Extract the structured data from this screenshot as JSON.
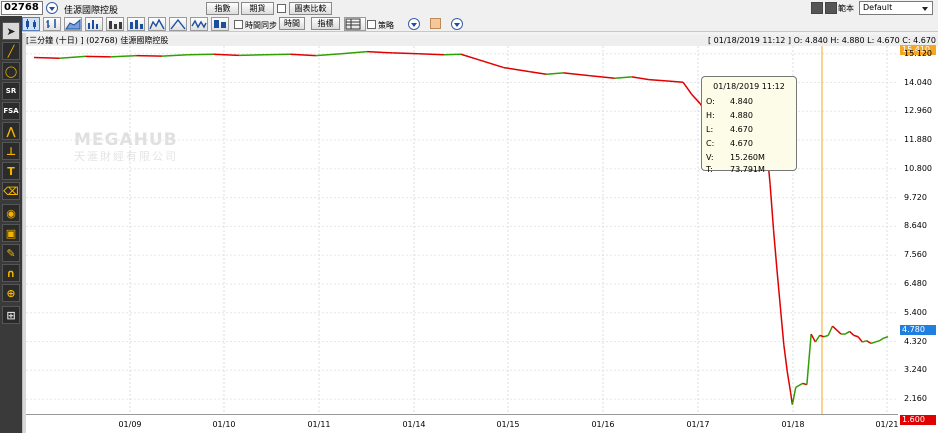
{
  "stock": {
    "code": "02768",
    "name": "佳源國際控股"
  },
  "toolbar": {
    "indicator_btn": "指數",
    "futures_btn": "期貨",
    "compare_btn": "圖表比較",
    "sync_label": "時間同步",
    "period_btn": "時間",
    "indicator2_btn": "指標",
    "strategy_label": "策略",
    "layout_label": "範本",
    "layout_value": "Default"
  },
  "chart_header": {
    "left": "[三分鐘 (十日) ] (02768) 佳源國際控股",
    "right": "[ 01/18/2019 11:12 ] O: 4.840 H: 4.880 L: 4.670 C: 4.670"
  },
  "watermark": {
    "brand": "MEGAHUB",
    "subtitle": "天滙財經有限公司"
  },
  "tooltip": {
    "title": "01/18/2019 11:12",
    "rows": [
      {
        "k": "O:",
        "v": "4.840"
      },
      {
        "k": "H:",
        "v": "4.880"
      },
      {
        "k": "L:",
        "v": "4.670"
      },
      {
        "k": "C:",
        "v": "4.670"
      },
      {
        "k": "V:",
        "v": "15.260M"
      },
      {
        "k": "T:",
        "v": "73.791M"
      }
    ]
  },
  "y_labels": [
    "15.120",
    "14.040",
    "12.960",
    "11.880",
    "10.800",
    "9.720",
    "8.640",
    "7.560",
    "6.480",
    "5.400",
    "4.320",
    "3.240",
    "2.160"
  ],
  "tags": {
    "high": "15.410",
    "current": "4.780",
    "low": "1.600"
  },
  "colors": {
    "up": "#2fa000",
    "down": "#e00000",
    "accent_line": "#f5a623",
    "current_tag": "#1e7fe0",
    "low_tag": "#e00000",
    "high_tag": "#f5a623"
  },
  "chart_data": {
    "type": "line",
    "x": [
      "01/09",
      "01/10",
      "01/11",
      "01/14",
      "01/15",
      "01/16",
      "01/17",
      "01/18",
      "01/21"
    ],
    "ylim": [
      1.6,
      15.41
    ],
    "series": [
      {
        "values": [
          [
            0,
            14.98
          ],
          [
            0.03,
            14.95
          ],
          [
            0.06,
            15.02
          ],
          [
            0.09,
            15.0
          ],
          [
            0.12,
            15.05
          ],
          [
            0.15,
            15.03
          ],
          [
            0.18,
            15.08
          ],
          [
            0.21,
            15.1
          ],
          [
            0.24,
            15.06
          ],
          [
            0.27,
            15.08
          ],
          [
            0.3,
            15.1
          ],
          [
            0.33,
            15.05
          ],
          [
            0.36,
            15.12
          ],
          [
            0.39,
            15.2
          ],
          [
            0.42,
            15.15
          ],
          [
            0.45,
            15.12
          ],
          [
            0.48,
            15.08
          ],
          [
            0.5,
            15.1
          ],
          [
            0.52,
            14.9
          ],
          [
            0.55,
            14.6
          ],
          [
            0.58,
            14.45
          ],
          [
            0.6,
            14.35
          ],
          [
            0.62,
            14.4
          ],
          [
            0.65,
            14.3
          ],
          [
            0.68,
            14.2
          ],
          [
            0.7,
            14.25
          ],
          [
            0.72,
            14.15
          ],
          [
            0.74,
            14.1
          ],
          [
            0.76,
            14.05
          ],
          [
            0.77,
            13.6
          ],
          [
            0.78,
            13.25
          ],
          [
            0.785,
            13.0
          ],
          [
            0.79,
            12.95
          ],
          [
            0.8,
            12.9
          ],
          [
            0.81,
            12.85
          ],
          [
            0.82,
            12.8
          ],
          [
            0.83,
            12.3
          ],
          [
            0.84,
            11.9
          ],
          [
            0.85,
            11.5
          ],
          [
            0.86,
            10.9
          ],
          [
            0.862,
            10.2
          ],
          [
            0.866,
            8.5
          ],
          [
            0.87,
            7.0
          ],
          [
            0.874,
            5.6
          ],
          [
            0.878,
            4.2
          ],
          [
            0.882,
            3.2
          ],
          [
            0.886,
            2.4
          ],
          [
            0.888,
            1.95
          ],
          [
            0.892,
            2.6
          ],
          [
            0.9,
            2.75
          ],
          [
            0.905,
            2.7
          ],
          [
            0.91,
            4.6
          ],
          [
            0.915,
            4.3
          ],
          [
            0.92,
            4.55
          ],
          [
            0.925,
            4.5
          ],
          [
            0.93,
            4.55
          ],
          [
            0.935,
            4.9
          ],
          [
            0.94,
            4.75
          ],
          [
            0.945,
            4.6
          ],
          [
            0.95,
            4.6
          ],
          [
            0.955,
            4.7
          ],
          [
            0.96,
            4.55
          ],
          [
            0.965,
            4.5
          ],
          [
            0.97,
            4.3
          ],
          [
            0.975,
            4.35
          ],
          [
            0.98,
            4.25
          ],
          [
            0.985,
            4.3
          ],
          [
            0.99,
            4.35
          ],
          [
            0.995,
            4.45
          ],
          [
            1.0,
            4.5
          ]
        ]
      }
    ]
  }
}
